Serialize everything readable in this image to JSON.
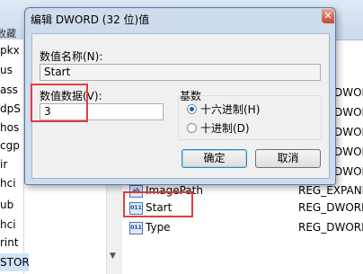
{
  "dialog": {
    "title": "编辑 DWORD (32 位)值",
    "value_name_label": "数值名称(N):",
    "value_name": "Start",
    "value_data_label": "数值数据(V):",
    "value_data": "3",
    "base_label": "基数",
    "hex_label": "十六进制(H)",
    "dec_label": "十进制(D)",
    "base_selected": "hex",
    "ok_label": "确定",
    "cancel_label": "取消"
  },
  "background": {
    "toolbar_fragment": "收藏",
    "tree_items": [
      "pkx",
      "us",
      "ass",
      "dpS",
      "hos",
      "cgp",
      "ir",
      "hci",
      "ub",
      "hci",
      "rint",
      "STOR"
    ],
    "right_types": [
      "DWORD",
      "DWORD",
      "DWORD",
      "DWORD",
      "DWORD",
      "DWORD",
      "DWORD"
    ],
    "rows": [
      {
        "name": "ImagePath",
        "type": "REG_EXPAND"
      },
      {
        "name": "Start",
        "type": "REG_DWORD"
      },
      {
        "name": "Type",
        "type": "REG_DWORD"
      }
    ]
  }
}
